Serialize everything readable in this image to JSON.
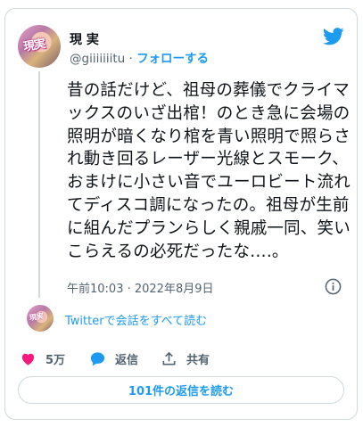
{
  "tweet": {
    "author_name": "現 実",
    "handle": "@giiiiiiitu",
    "separator": " · ",
    "follow_label": "フォローする",
    "avatar_text": "現実",
    "text": "昔の話だけど、祖母の葬儀でクライマックスのいざ出棺！のとき急に会場の照明が暗くなり棺を青い照明で照らされ動き回るレーザー光線とスモーク、おまけに小さい音でユーロビート流れてディスコ調になったの。祖母が生前に組んだプランらしく親戚一同、笑いこらえるの必死だったな….。",
    "timestamp": "午前10:03 · 2022年8月9日"
  },
  "thread": {
    "read_all_label": "Twitterで会話をすべて読む"
  },
  "actions": {
    "like_count": "5万",
    "reply_label": "返信",
    "share_label": "共有"
  },
  "replies_button": {
    "label": "101件の返信を読む"
  },
  "icons": {
    "brand": "twitter-bird-icon",
    "like": "heart-icon",
    "reply": "speech-bubble-icon",
    "share": "share-upload-icon",
    "info": "info-icon"
  },
  "colors": {
    "accent": "#1d9bf0",
    "like": "#f91880",
    "text": "#0f1419",
    "secondary": "#536471",
    "border": "#cfd9de"
  }
}
